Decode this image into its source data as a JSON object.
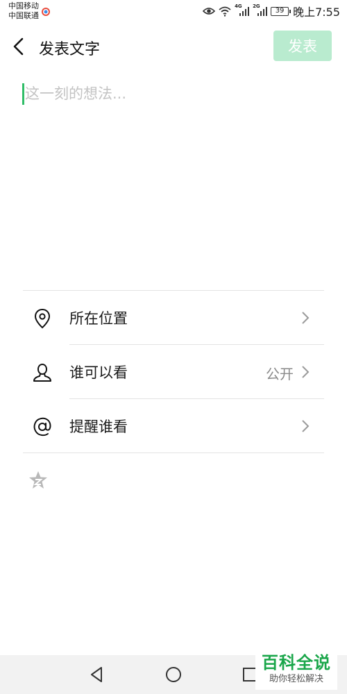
{
  "status_bar": {
    "carrier_1": "中国移动",
    "carrier_2": "中国联通",
    "net_1": "4G",
    "net_2": "2G",
    "battery": "39",
    "time": "晚上7:55"
  },
  "header": {
    "title": "发表文字",
    "publish_label": "发表",
    "publish_color": "#b9ebcf"
  },
  "compose": {
    "placeholder": "这一刻的想法...",
    "value": "",
    "cursor_color": "#2fbd67"
  },
  "options": [
    {
      "icon": "location-pin-icon",
      "label": "所在位置",
      "value": ""
    },
    {
      "icon": "person-icon",
      "label": "谁可以看",
      "value": "公开"
    },
    {
      "icon": "at-sign-icon",
      "label": "提醒谁看",
      "value": ""
    }
  ],
  "footer_icon": "emoji-face-icon",
  "nav": {
    "back": "back-triangle-icon",
    "home": "home-circle-icon",
    "recents": "recents-square-icon"
  },
  "watermark": {
    "main": "百科全说",
    "sub": "助你轻松解决"
  }
}
